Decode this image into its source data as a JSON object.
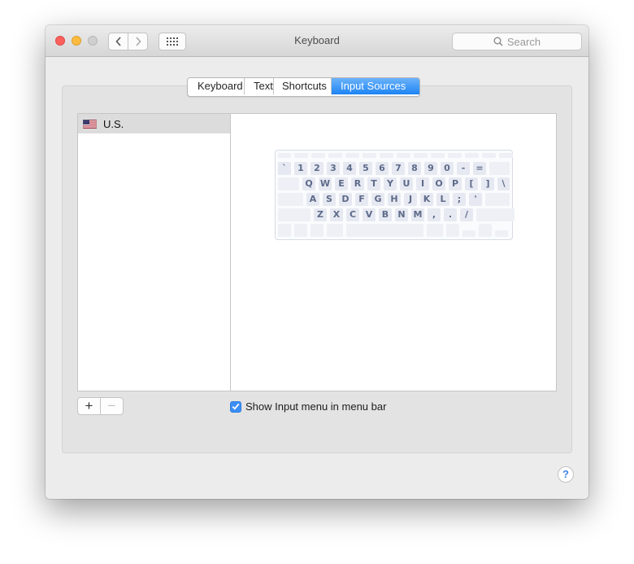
{
  "window": {
    "title": "Keyboard"
  },
  "toolbar": {
    "search_placeholder": "Search"
  },
  "tabs": [
    {
      "label": "Keyboard",
      "active": false
    },
    {
      "label": "Text",
      "active": false
    },
    {
      "label": "Shortcuts",
      "active": false
    },
    {
      "label": "Input Sources",
      "active": true
    }
  ],
  "sources": [
    {
      "label": "U.S.",
      "icon": "us-flag-icon"
    }
  ],
  "keyboard_layout": {
    "rows": [
      [
        "`",
        "1",
        "2",
        "3",
        "4",
        "5",
        "6",
        "7",
        "8",
        "9",
        "0",
        "-",
        "="
      ],
      [
        "Q",
        "W",
        "E",
        "R",
        "T",
        "Y",
        "U",
        "I",
        "O",
        "P",
        "[",
        "]",
        "\\"
      ],
      [
        "A",
        "S",
        "D",
        "F",
        "G",
        "H",
        "J",
        "K",
        "L",
        ";",
        "'"
      ],
      [
        "Z",
        "X",
        "C",
        "V",
        "B",
        "N",
        "M",
        ",",
        ".",
        "/"
      ]
    ]
  },
  "options": {
    "show_input_menu_label": "Show Input menu in menu bar",
    "show_input_menu_checked": true
  },
  "help": {
    "label": "?"
  },
  "colors": {
    "accent": "#1d84f4",
    "key_text": "#5d6a8a"
  }
}
